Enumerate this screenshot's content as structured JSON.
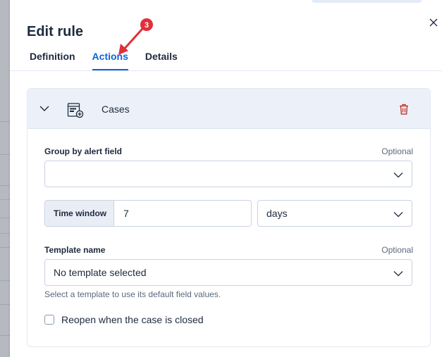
{
  "flyout": {
    "title": "Edit rule",
    "tabs": [
      {
        "label": "Definition",
        "active": false
      },
      {
        "label": "Actions",
        "active": true
      },
      {
        "label": "Details",
        "active": false
      }
    ]
  },
  "annotation": {
    "step": "3",
    "color": "#e0303a"
  },
  "action_card": {
    "title": "Cases",
    "icon": "cases-icon",
    "group_by": {
      "label": "Group by alert field",
      "optional": "Optional",
      "value": ""
    },
    "time_window": {
      "label": "Time window",
      "value": "7",
      "unit": "days"
    },
    "template": {
      "label": "Template name",
      "optional": "Optional",
      "value": "No template selected",
      "help": "Select a template to use its default field values."
    },
    "reopen": {
      "label": "Reopen when the case is closed",
      "checked": false
    }
  },
  "colors": {
    "accent": "#0b64dd",
    "danger": "#bd271e",
    "header_bg": "#ecf1f9"
  }
}
